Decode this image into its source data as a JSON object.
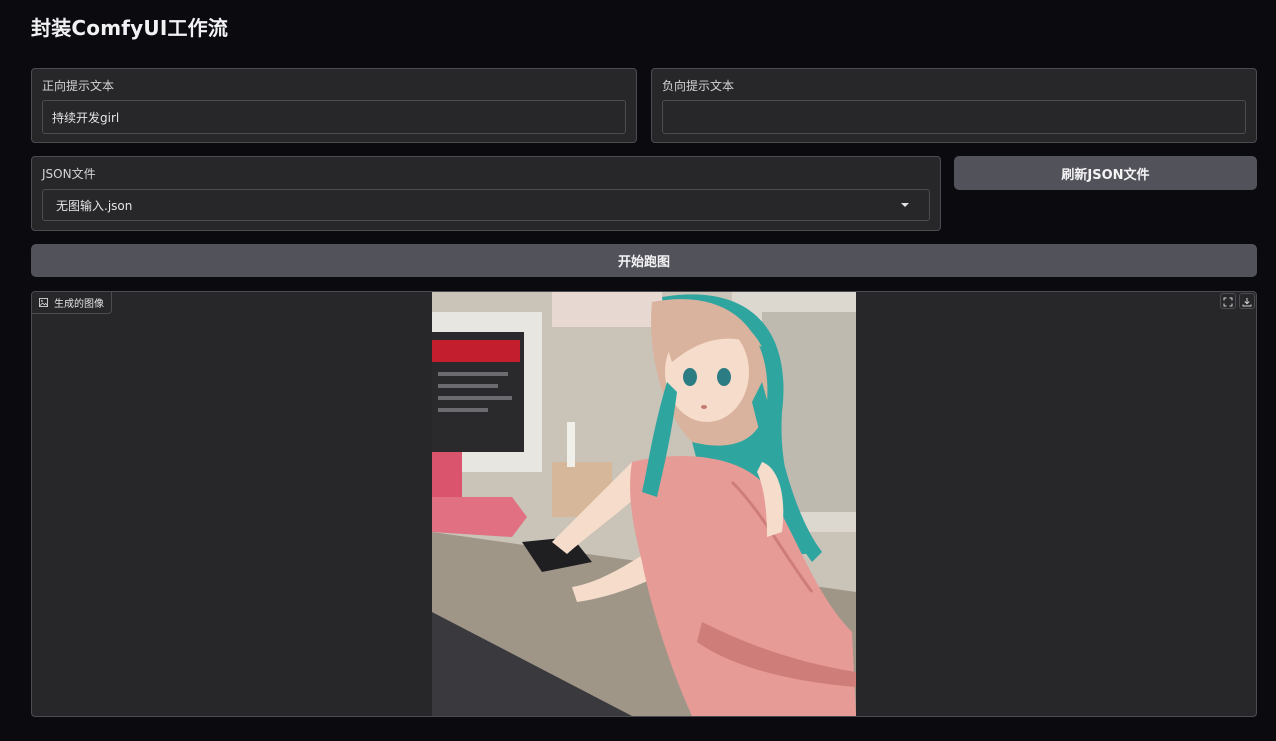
{
  "title": "封装ComfyUI工作流",
  "positive_prompt": {
    "label": "正向提示文本",
    "value": "持续开发girl"
  },
  "negative_prompt": {
    "label": "负向提示文本",
    "value": ""
  },
  "json_file": {
    "label": "JSON文件",
    "selected": "无图输入.json"
  },
  "buttons": {
    "refresh_json": "刷新JSON文件",
    "start_run": "开始跑图"
  },
  "output_image": {
    "label": "生成的图像",
    "image_icon": "image-icon",
    "fullscreen_icon": "fullscreen-icon",
    "download_icon": "download-icon"
  },
  "colors": {
    "background": "#0b0b0f",
    "panel": "#27272a",
    "border": "#4b4b52",
    "button": "#52525b",
    "hair": "#2fa5a0",
    "dress": "#e79b96"
  }
}
